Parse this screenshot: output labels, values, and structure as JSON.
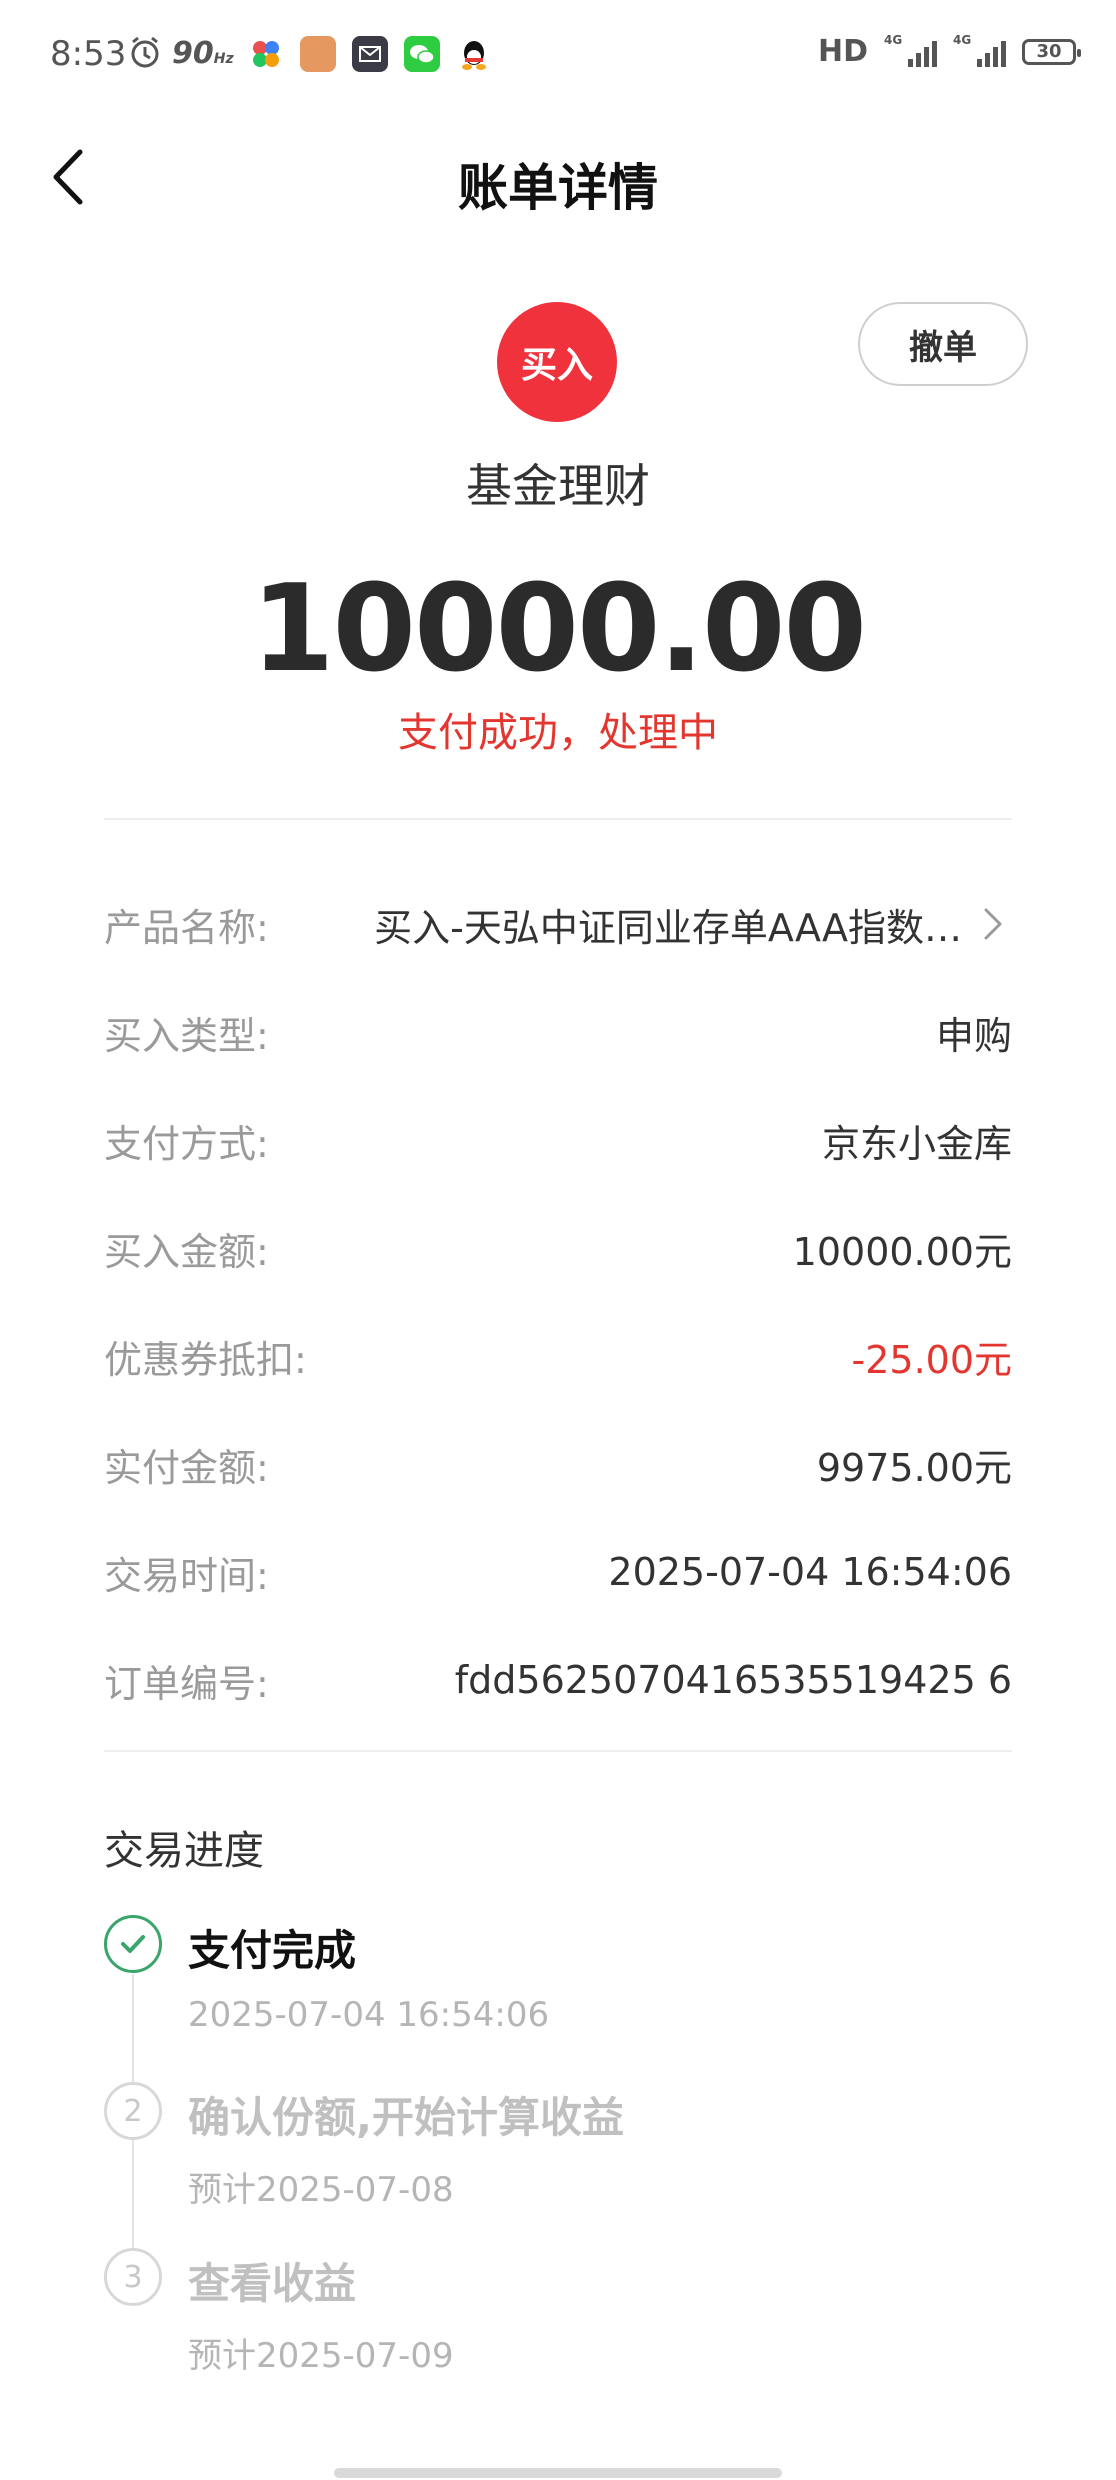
{
  "status_bar": {
    "time": "8:53",
    "refresh_rate": "90",
    "refresh_unit": "Hz",
    "hd_label": "HD",
    "signal_labels": [
      "4G",
      "4G"
    ],
    "battery": "30"
  },
  "nav": {
    "title": "账单详情"
  },
  "header": {
    "badge": "买入",
    "cancel_label": "撤单",
    "category": "基金理财",
    "amount": "10000.00",
    "status": "支付成功，处理中",
    "badge_color": "#f0323c",
    "status_color": "#e2362f"
  },
  "details": {
    "rows": [
      {
        "label": "产品名称:",
        "value": "买入-天弘中证同业存单AAA指数…"
      },
      {
        "label": "买入类型:",
        "value": "申购"
      },
      {
        "label": "支付方式:",
        "value": "京东小金库"
      },
      {
        "label": "买入金额:",
        "value": "10000.00元"
      },
      {
        "label": "优惠券抵扣:",
        "value": "-25.00元"
      },
      {
        "label": "实付金额:",
        "value": "9975.00元"
      },
      {
        "label": "交易时间:",
        "value": "2025-07-04 16:54:06"
      },
      {
        "label": "订单编号:",
        "value": "fdd5625070416535519425 6"
      }
    ]
  },
  "progress": {
    "title": "交易进度",
    "steps": [
      {
        "number": "",
        "title": "支付完成",
        "subtitle": "2025-07-04 16:54:06",
        "done": true
      },
      {
        "number": "2",
        "title": "确认份额,开始计算收益",
        "subtitle": "预计2025-07-08",
        "done": false
      },
      {
        "number": "3",
        "title": "查看收益",
        "subtitle": "预计2025-07-09",
        "done": false
      }
    ],
    "done_color": "#3aa46a"
  }
}
